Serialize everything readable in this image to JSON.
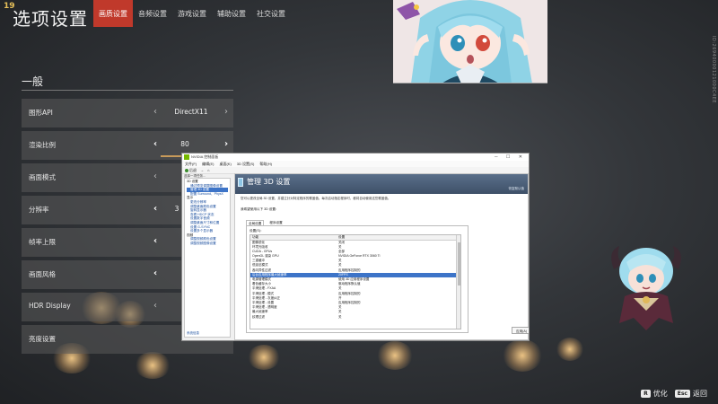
{
  "game": {
    "badge": "19",
    "title": "选项设置",
    "tabs": [
      {
        "label": "画质设置",
        "active": true
      },
      {
        "label": "音频设置",
        "active": false
      },
      {
        "label": "游戏设置",
        "active": false
      },
      {
        "label": "辅助设置",
        "active": false
      },
      {
        "label": "社交设置",
        "active": false
      }
    ],
    "side_id": "ID:26940000121000C4EE",
    "section_title": "一般",
    "settings": [
      {
        "label": "图形API",
        "value": "DirectX11"
      },
      {
        "label": "渲染比例",
        "value": "80"
      },
      {
        "label": "画面模式",
        "value": ""
      },
      {
        "label": "分辨率",
        "value": "3"
      },
      {
        "label": "帧率上限",
        "value": ""
      },
      {
        "label": "画面风格",
        "value": ""
      },
      {
        "label": "HDR Display",
        "value": ""
      },
      {
        "label": "亮度设置",
        "value": ""
      }
    ],
    "hints": [
      {
        "key": "R",
        "label": "优化"
      },
      {
        "key": "Esc",
        "label": "返回"
      }
    ],
    "accent_color": "#c0392b"
  },
  "nvidia": {
    "window_title": "NVIDIA 控制面板",
    "menu": [
      "文件(F)",
      "编辑(E)",
      "桌面(K)",
      "3D 设置(S)",
      "帮助(H)"
    ],
    "toolbar": {
      "back": "后退",
      "forward": "→"
    },
    "task_label": "选择一项任务...",
    "tree": [
      {
        "text": "3D 设置",
        "type": "cat"
      },
      {
        "text": "通过预览调整图像设置",
        "type": "item"
      },
      {
        "text": "管理 3D 设置",
        "type": "selected"
      },
      {
        "text": "配置 Surround、PhysX",
        "type": "item"
      },
      {
        "text": "显示",
        "type": "cat"
      },
      {
        "text": "更改分辨率",
        "type": "item"
      },
      {
        "text": "调整桌面颜色设置",
        "type": "item"
      },
      {
        "text": "旋转显示器",
        "type": "item"
      },
      {
        "text": "查看 HDCP 状态",
        "type": "item"
      },
      {
        "text": "设置数字音频",
        "type": "item"
      },
      {
        "text": "调整桌面尺寸和位置",
        "type": "item"
      },
      {
        "text": "设置 G-SYNC",
        "type": "item"
      },
      {
        "text": "设置多个显示器",
        "type": "item"
      },
      {
        "text": "视频",
        "type": "cat"
      },
      {
        "text": "调整视频颜色设置",
        "type": "item"
      },
      {
        "text": "调整视频图像设置",
        "type": "item"
      }
    ],
    "system_info": "系统信息",
    "header_title": "管理 3D 设置",
    "restore": "恢复默认值",
    "description": "您可以更改全局 3D 设置，并建立针对特定程序的覆盖值。每次启动指定程序时，都将自动使用这些覆盖值。",
    "prompt": "我希望使用以下 3D 设置：",
    "subtabs": [
      {
        "label": "全局设置",
        "active": true
      },
      {
        "label": "程序设置",
        "active": false
      }
    ],
    "grid_caption": "设置(S)：",
    "columns": [
      "功能",
      "设置"
    ],
    "rows": [
      {
        "feature": "图像锐化",
        "setting": "关闭",
        "selected": false
      },
      {
        "feature": "环境光吸收",
        "setting": "关",
        "selected": false
      },
      {
        "feature": "CUDA - GPUs",
        "setting": "全部",
        "selected": false
      },
      {
        "feature": "OpenGL 渲染 GPU",
        "setting": "NVIDIA GeForce RTX 3060 Ti",
        "selected": false
      },
      {
        "feature": "三重缓冲",
        "setting": "关",
        "selected": false
      },
      {
        "feature": "低延迟模式",
        "setting": "关",
        "selected": false
      },
      {
        "feature": "各向异性过滤",
        "setting": "应用程序控制的",
        "selected": false
      },
      {
        "feature": "后台应用程序最大帧速率",
        "setting": "20FPS",
        "selected": true
      },
      {
        "feature": "电源管理模式",
        "setting": "使用 3D 应用程序设置",
        "selected": false
      },
      {
        "feature": "着色缓存大小",
        "setting": "驱动程序默认值",
        "selected": false
      },
      {
        "feature": "平滑处理 - FXAA",
        "setting": "关",
        "selected": false
      },
      {
        "feature": "平滑处理 - 模式",
        "setting": "应用程序控制的",
        "selected": false
      },
      {
        "feature": "平滑处理 - 灰度纠正",
        "setting": "开",
        "selected": false
      },
      {
        "feature": "平滑处理 - 设置",
        "setting": "应用程序控制的",
        "selected": false
      },
      {
        "feature": "平滑处理 - 透明度",
        "setting": "关",
        "selected": false
      },
      {
        "feature": "最大帧速率",
        "setting": "关",
        "selected": false
      },
      {
        "feature": "纹理过滤",
        "setting": "关",
        "selected": false
      }
    ],
    "apply_label": "应用(A)",
    "brand_color": "#76b900"
  }
}
